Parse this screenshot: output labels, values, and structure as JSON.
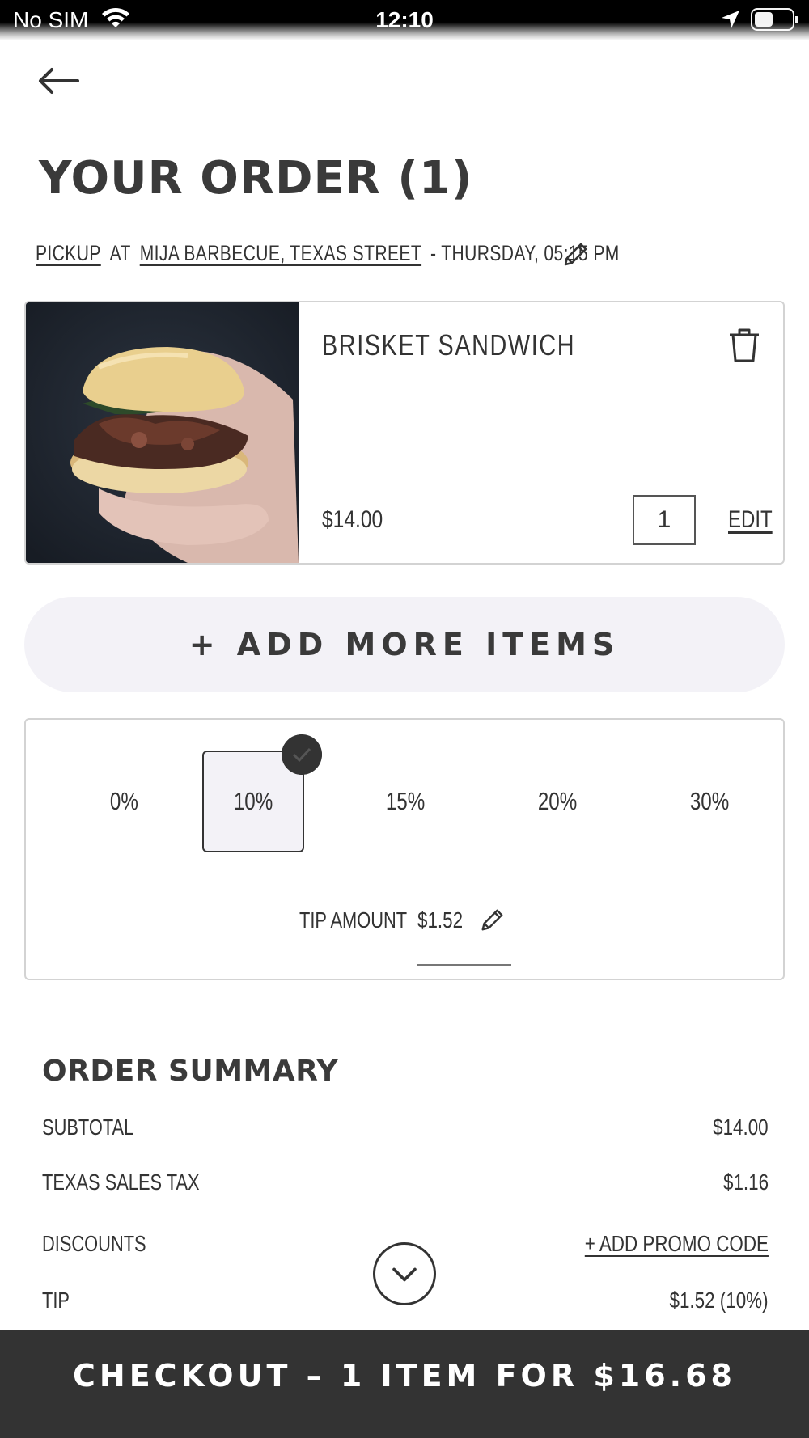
{
  "status_bar": {
    "carrier": "No SIM",
    "time": "12:10"
  },
  "header": {
    "title": "YOUR ORDER (1)"
  },
  "pickup": {
    "mode": "PICKUP",
    "at": "AT",
    "location": "MIJA BARBECUE, TEXAS STREET",
    "time": "- THURSDAY, 05:15 PM"
  },
  "item": {
    "name": "BRISKET SANDWICH",
    "price": "$14.00",
    "quantity": "1",
    "edit_label": "EDIT"
  },
  "add_more_label": "+ ADD MORE ITEMS",
  "tip": {
    "options": [
      "0%",
      "10%",
      "15%",
      "20%",
      "30%"
    ],
    "selected": "10%",
    "amount_label": "TIP AMOUNT",
    "amount_value": "$1.52"
  },
  "summary": {
    "title": "ORDER SUMMARY",
    "rows": [
      {
        "label": "SUBTOTAL",
        "value": "$14.00"
      },
      {
        "label": "TEXAS SALES TAX",
        "value": "$1.16"
      },
      {
        "label": "DISCOUNTS",
        "value": "+ ADD PROMO CODE"
      },
      {
        "label": "TIP",
        "value": "$1.52 (10%)"
      }
    ]
  },
  "checkout_label": "CHECKOUT – 1 ITEM FOR $16.68",
  "colors": {
    "dark": "#333333",
    "light_pill": "#f3f2f7",
    "border": "#d3d3d3"
  }
}
